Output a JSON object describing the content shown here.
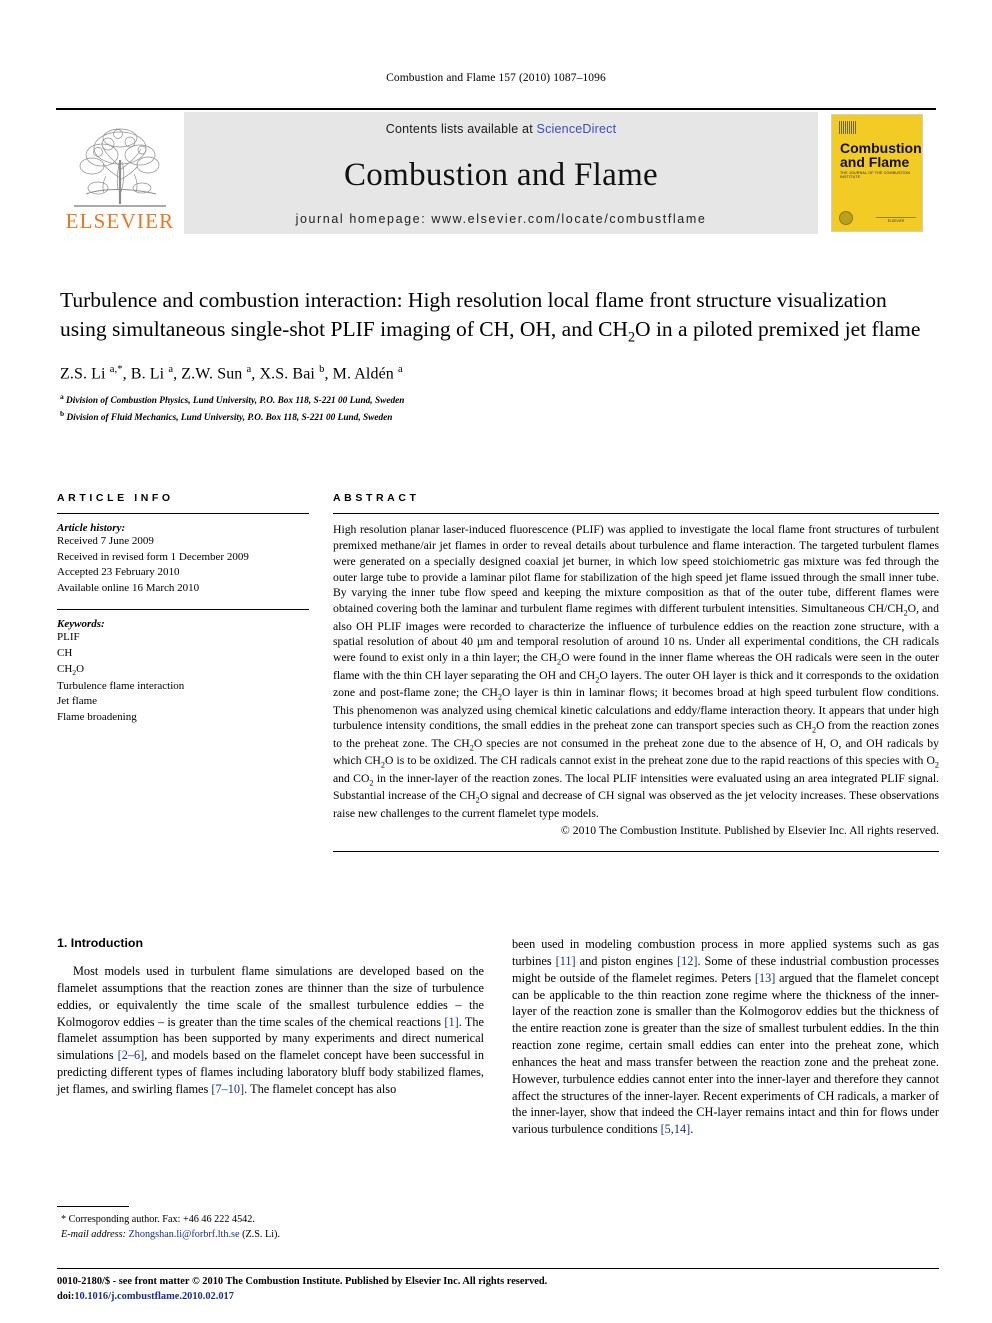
{
  "running_head": "Combustion and Flame 157 (2010) 1087–1096",
  "masthead": {
    "publisher_name": "ELSEVIER",
    "contents_prefix": "Contents lists available at ",
    "sciencedirect": "ScienceDirect",
    "journal_title": "Combustion and Flame",
    "homepage": "journal homepage: www.elsevier.com/locate/combustflame",
    "cover": {
      "line1": "Combustion",
      "line2": "and Flame",
      "subtitle": "THE JOURNAL OF THE COMBUSTION INSTITUTE",
      "publisher_mark": "ELSEVIER"
    }
  },
  "article": {
    "title_part1": "Turbulence and combustion interaction: High resolution local flame front structure visualization using simultaneous single-shot PLIF imaging of CH, OH, and CH",
    "title_sub": "2",
    "title_part2": "O in a piloted premixed jet flame",
    "authors": "Z.S. Li a,*, B. Li a, Z.W. Sun a, X.S. Bai b, M. Aldén a",
    "affiliation_a": "Division of Combustion Physics, Lund University, P.O. Box 118, S-221 00 Lund, Sweden",
    "affiliation_b": "Division of Fluid Mechanics, Lund University, P.O. Box 118, S-221 00 Lund, Sweden"
  },
  "info": {
    "heading": "ARTICLE INFO",
    "history_label": "Article history:",
    "history": [
      "Received 7 June 2009",
      "Received in revised form 1 December 2009",
      "Accepted 23 February 2010",
      "Available online 16 March 2010"
    ],
    "keywords_label": "Keywords:",
    "keywords": [
      "PLIF",
      "CH",
      "CH2O",
      "Turbulence flame interaction",
      "Jet flame",
      "Flame broadening"
    ]
  },
  "abstract": {
    "heading": "ABSTRACT",
    "paragraphs": [
      "High resolution planar laser-induced fluorescence (PLIF) was applied to investigate the local flame front structures of turbulent premixed methane/air jet flames in order to reveal details about turbulence and flame interaction. The targeted turbulent flames were generated on a specially designed coaxial jet burner, in which low speed stoichiometric gas mixture was fed through the outer large tube to provide a laminar pilot flame for stabilization of the high speed jet flame issued through the small inner tube. By varying the inner tube flow speed and keeping the mixture composition as that of the outer tube, different flames were obtained covering both the laminar and turbulent flame regimes with different turbulent intensities. Simultaneous CH/CH2O, and also OH PLIF images were recorded to characterize the influence of turbulence eddies on the reaction zone structure, with a spatial resolution of about 40 µm and temporal resolution of around 10 ns. Under all experimental conditions, the CH radicals were found to exist only in a thin layer; the CH2O were found in the inner flame whereas the OH radicals were seen in the outer flame with the thin CH layer separating the OH and CH2O layers. The outer OH layer is thick and it corresponds to the oxidation zone and post-flame zone; the CH2O layer is thin in laminar flows; it becomes broad at high speed turbulent flow conditions. This phenomenon was analyzed using chemical kinetic calculations and eddy/flame interaction theory. It appears that under high turbulence intensity conditions, the small eddies in the preheat zone can transport species such as CH2O from the reaction zones to the preheat zone. The CH2O species are not consumed in the preheat zone due to the absence of H, O, and OH radicals by which CH2O is to be oxidized. The CH radicals cannot exist in the preheat zone due to the rapid reactions of this species with O2 and CO2 in the inner-layer of the reaction zones. The local PLIF intensities were evaluated using an area integrated PLIF signal. Substantial increase of the CH2O signal and decrease of CH signal was observed as the jet velocity increases. These observations raise new challenges to the current flamelet type models."
    ],
    "copyright": "© 2010 The Combustion Institute. Published by Elsevier Inc. All rights reserved."
  },
  "body": {
    "section_heading": "1. Introduction",
    "left_paragraph": "Most models used in turbulent flame simulations are developed based on the flamelet assumptions that the reaction zones are thinner than the size of turbulence eddies, or equivalently the time scale of the smallest turbulence eddies – the Kolmogorov eddies – is greater than the time scales of the chemical reactions [1]. The flamelet assumption has been supported by many experiments and direct numerical simulations [2–6], and models based on the flamelet concept have been successful in predicting different types of flames including laboratory bluff body stabilized flames, jet flames, and swirling flames [7–10]. The flamelet concept has also",
    "right_paragraph": "been used in modeling combustion process in more applied systems such as gas turbines [11] and piston engines [12]. Some of these industrial combustion processes might be outside of the flamelet regimes. Peters [13] argued that the flamelet concept can be applicable to the thin reaction zone regime where the thickness of the inner-layer of the reaction zone is smaller than the Kolmogorov eddies but the thickness of the entire reaction zone is greater than the size of smallest turbulent eddies. In the thin reaction zone regime, certain small eddies can enter into the preheat zone, which enhances the heat and mass transfer between the reaction zone and the preheat zone. However, turbulence eddies cannot enter into the inner-layer and therefore they cannot affect the structures of the inner-layer. Recent experiments of CH radicals, a marker of the inner-layer, show that indeed the CH-layer remains intact and thin for flows under various turbulence conditions [5,14]."
  },
  "footnote": {
    "corresponding": "* Corresponding author. Fax: +46 46 222 4542.",
    "email_label": "E-mail address:",
    "email": "Zhongshan.li@forbrf.lth.se",
    "email_suffix": "(Z.S. Li)."
  },
  "footer": {
    "issn_line": "0010-2180/$ - see front matter © 2010 The Combustion Institute. Published by Elsevier Inc. All rights reserved.",
    "doi_label": "doi:",
    "doi": "10.1016/j.combustflame.2010.02.017"
  },
  "colors": {
    "link": "#1c2f86",
    "sciencedirect": "#3b4cc0",
    "elsevier_orange": "#e87722",
    "cover_yellow": "#f2cc25",
    "masthead_grey": "#e6e6e6"
  }
}
